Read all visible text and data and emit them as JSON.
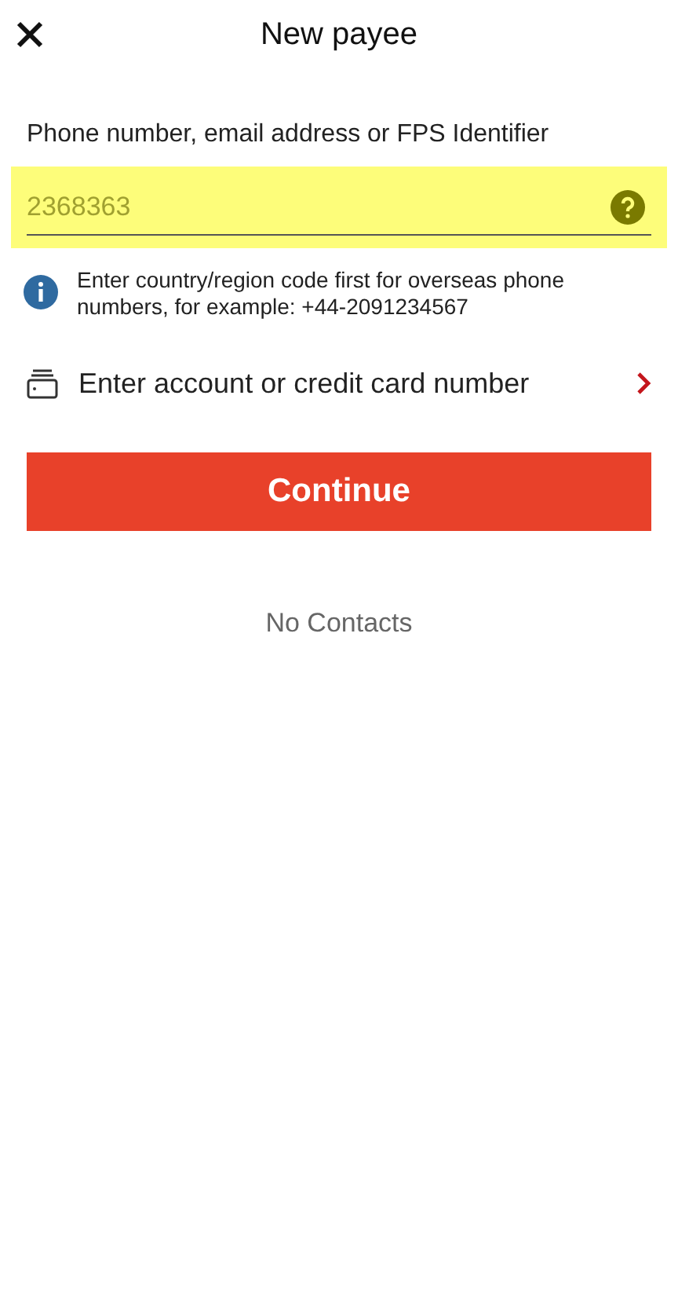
{
  "header": {
    "title": "New payee"
  },
  "field": {
    "label": "Phone number, email address or FPS Identifier",
    "placeholder": "2368363",
    "highlighted": true
  },
  "info": {
    "text": "Enter country/region code first for overseas phone numbers, for example: +44-2091234567"
  },
  "account_link": {
    "label": "Enter account or credit card number"
  },
  "continue_button": {
    "label": "Continue"
  },
  "contacts": {
    "empty_text": "No Contacts"
  }
}
